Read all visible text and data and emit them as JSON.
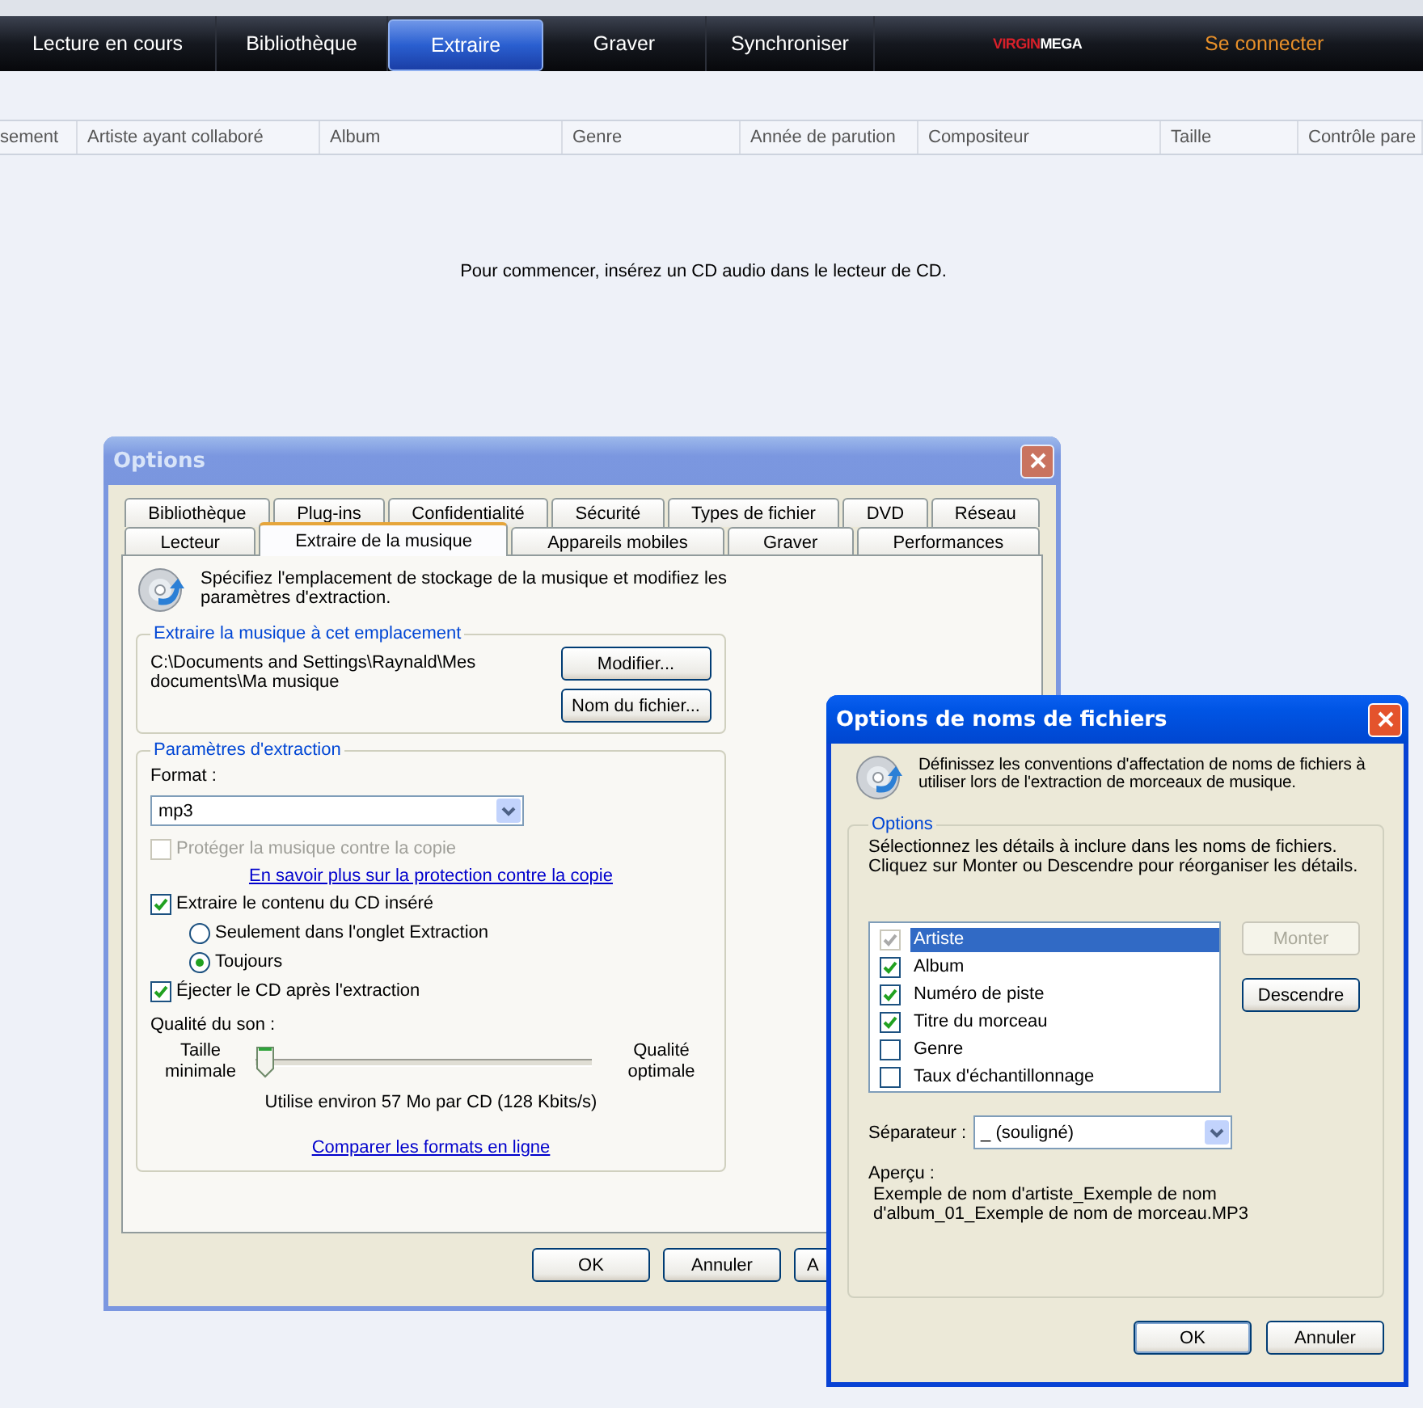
{
  "player": {
    "nav_tabs": [
      {
        "label": "Lecture en cours",
        "selected": false
      },
      {
        "label": "Bibliothèque",
        "selected": false
      },
      {
        "label": "Extraire",
        "selected": true
      },
      {
        "label": "Graver",
        "selected": false
      },
      {
        "label": "Synchroniser",
        "selected": false
      }
    ],
    "logo": {
      "part_1": "VIRGIN",
      "part_2": "MEGA"
    },
    "sign_in": "Se connecter",
    "columns": [
      "sement",
      "Artiste ayant collaboré",
      "Album",
      "Genre",
      "Année de parution",
      "Compositeur",
      "Taille",
      "Contrôle pare"
    ],
    "empty_message": "Pour commencer, insérez un CD audio dans le lecteur de CD."
  },
  "options_dialog": {
    "title": "Options",
    "tabs_row_1": [
      {
        "label": "Bibliothèque",
        "selected": false
      },
      {
        "label": "Plug-ins",
        "selected": false
      },
      {
        "label": "Confidentialité",
        "selected": false
      },
      {
        "label": "Sécurité",
        "selected": false
      },
      {
        "label": "Types de fichier",
        "selected": false
      },
      {
        "label": "DVD",
        "selected": false
      },
      {
        "label": "Réseau",
        "selected": false
      }
    ],
    "tabs_row_2": [
      {
        "label": "Lecteur",
        "selected": false
      },
      {
        "label": "Extraire de la musique",
        "selected": true
      },
      {
        "label": "Appareils mobiles",
        "selected": false
      },
      {
        "label": "Graver",
        "selected": false
      },
      {
        "label": "Performances",
        "selected": false
      }
    ],
    "intro": "Spécifiez l'emplacement de stockage de la musique et modifiez les paramètres d'extraction.",
    "location": {
      "legend": "Extraire la musique à cet emplacement",
      "path": "C:\\Documents and Settings\\Raynald\\Mes documents\\Ma musique",
      "buttons": [
        "Modifier...",
        "Nom du fichier..."
      ]
    },
    "extraction": {
      "legend": "Paramètres d'extraction",
      "format_label": "Format :",
      "format_value": "mp3",
      "protect": {
        "label": "Protéger la musique contre la copie",
        "checked": false,
        "disabled": true
      },
      "protect_link": "En savoir plus sur la protection contre la copie",
      "rip_cd": {
        "label": "Extraire le contenu du CD inséré",
        "checked": true
      },
      "rip_modes": [
        {
          "label": "Seulement dans l'onglet Extraction",
          "selected": false
        },
        {
          "label": "Toujours",
          "selected": true
        }
      ],
      "eject": {
        "label": "Éjecter le CD après l'extraction",
        "checked": true
      },
      "quality_label": "Qualité du son :",
      "slider_min": "Taille minimale",
      "slider_max": "Qualité optimale",
      "level": 0,
      "usage": "Utilise environ 57 Mo par CD (128 Kbits/s)",
      "compare_link": "Comparer les formats en ligne"
    },
    "buttons": [
      "OK",
      "Annuler",
      "A"
    ]
  },
  "filename_dialog": {
    "title": "Options de noms de fichiers",
    "intro": "Définissez les conventions d'affectation de noms de fichiers à utiliser lors de l'extraction de morceaux de musique.",
    "legend": "Options",
    "instructions": [
      "Sélectionnez les détails à inclure dans les noms de fichiers.",
      "Cliquez sur Monter ou Descendre pour réorganiser les détails."
    ],
    "details": [
      {
        "label": "Artiste",
        "checked": true,
        "selected": true
      },
      {
        "label": "Album",
        "checked": true,
        "selected": false
      },
      {
        "label": "Numéro de piste",
        "checked": true,
        "selected": false
      },
      {
        "label": "Titre du morceau",
        "checked": true,
        "selected": false
      },
      {
        "label": "Genre",
        "checked": false,
        "selected": false
      },
      {
        "label": "Taux d'échantillonnage",
        "checked": false,
        "selected": false
      }
    ],
    "up_button": {
      "label": "Monter",
      "disabled": true
    },
    "down_button": {
      "label": "Descendre",
      "disabled": false
    },
    "separator_label": "Séparateur :",
    "separator_value": "_ (souligné)",
    "preview_label": "Aperçu :",
    "preview": "Exemple de nom d'artiste_Exemple de nom d'album_01_Exemple de nom de morceau.MP3",
    "buttons": [
      "OK",
      "Annuler"
    ]
  }
}
